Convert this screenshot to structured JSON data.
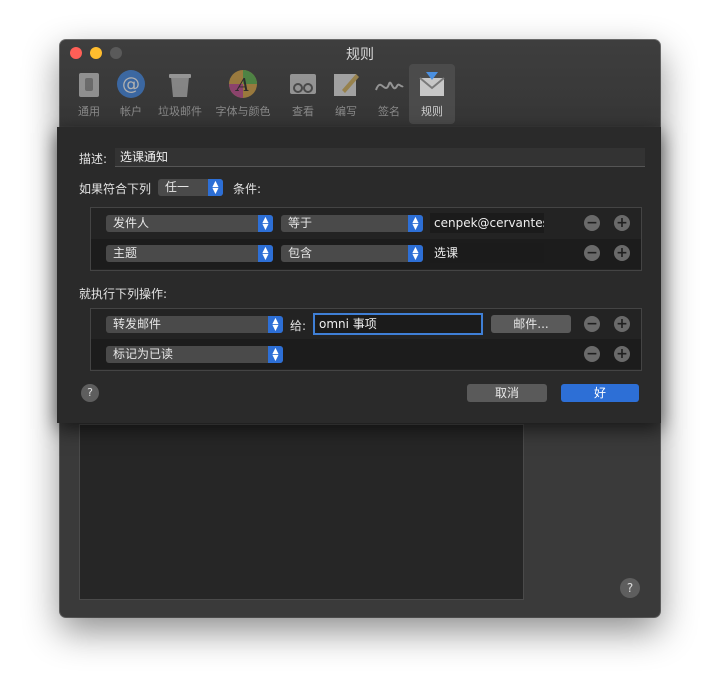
{
  "window": {
    "title": "规则"
  },
  "toolbar": {
    "items": [
      {
        "label": "通用",
        "icon": "general-icon"
      },
      {
        "label": "帐户",
        "icon": "accounts-icon"
      },
      {
        "label": "垃圾邮件",
        "icon": "junk-mail-icon"
      },
      {
        "label": "字体与颜色",
        "icon": "fonts-colors-icon"
      },
      {
        "label": "查看",
        "icon": "viewing-icon"
      },
      {
        "label": "编写",
        "icon": "composing-icon"
      },
      {
        "label": "签名",
        "icon": "signatures-icon"
      },
      {
        "label": "规则",
        "icon": "rules-icon",
        "selected": true
      }
    ]
  },
  "sheet": {
    "description_label": "描述:",
    "description_value": "选课通知",
    "match_prefix": "如果符合下列",
    "match_value": "任一",
    "conditions_label": "条件:",
    "conditions": [
      {
        "field": "发件人",
        "operator": "等于",
        "value": "cenpek@cervantes"
      },
      {
        "field": "主题",
        "operator": "包含",
        "value": "选课"
      }
    ],
    "actions_label": "就执行下列操作:",
    "actions": [
      {
        "action": "转发邮件",
        "to_label": "给:",
        "to_value": "omni 事项",
        "mail_button": "邮件..."
      },
      {
        "action": "标记为已读"
      }
    ],
    "help": "?",
    "cancel": "取消",
    "ok": "好"
  },
  "window_help": "?",
  "colors": {
    "accent": "#2d6fd6",
    "window_bg": "#3a3a3a",
    "sheet_bg": "#2a2a2a"
  }
}
